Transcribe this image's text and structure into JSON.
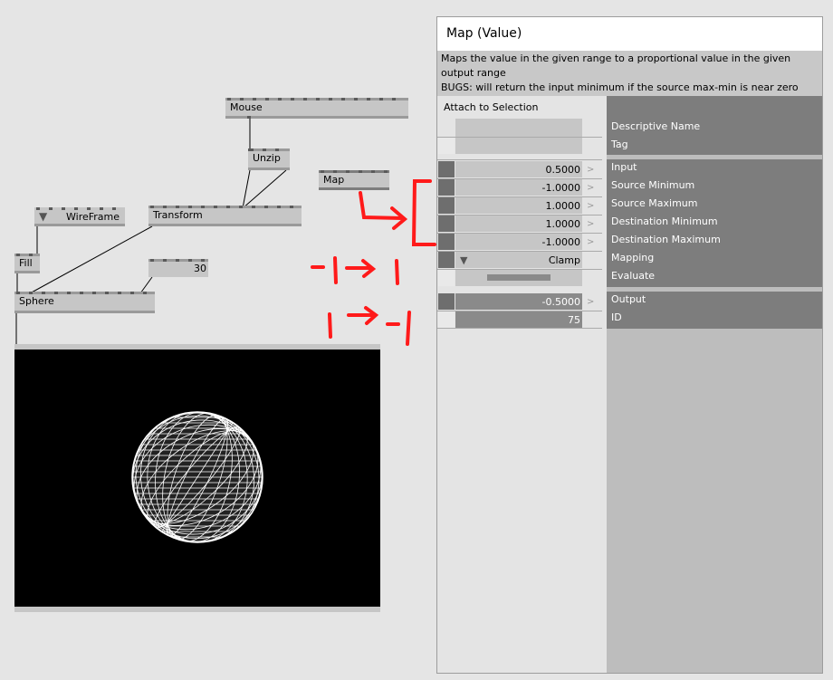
{
  "nodes": {
    "mouse": "Mouse",
    "unzip": "Unzip",
    "map": "Map",
    "wireframe": "WireFrame",
    "transform": "Transform",
    "fill": "Fill",
    "sphere": "Sphere",
    "iobox_value": "30"
  },
  "inspector": {
    "title": "Map (Value)",
    "description_line1": "Maps the value in the given range to a proportional value in the given",
    "description_line2": "output range",
    "description_line3": "BUGS: will return the input minimum if the source max-min is near zero",
    "attach_label": "Attach to Selection",
    "rows": [
      {
        "label": "Descriptive Name",
        "value": ""
      },
      {
        "label": "Tag",
        "value": ""
      },
      {
        "label": "Input",
        "value": "0.5000"
      },
      {
        "label": "Source Minimum",
        "value": "-1.0000"
      },
      {
        "label": "Source Maximum",
        "value": "1.0000"
      },
      {
        "label": "Destination Minimum",
        "value": "1.0000"
      },
      {
        "label": "Destination Maximum",
        "value": "-1.0000"
      },
      {
        "label": "Mapping",
        "value": "Clamp"
      },
      {
        "label": "Evaluate",
        "value": ""
      },
      {
        "label": "Output",
        "value": "-0.5000"
      },
      {
        "label": "ID",
        "value": "75"
      }
    ],
    "arrow_glyph": ">",
    "dropdown_glyph": "▼"
  },
  "colors": {
    "annotation_red": "#ff1a1a",
    "inspector_dark": "#7d7d7d",
    "node_gray": "#c6c6c6"
  }
}
